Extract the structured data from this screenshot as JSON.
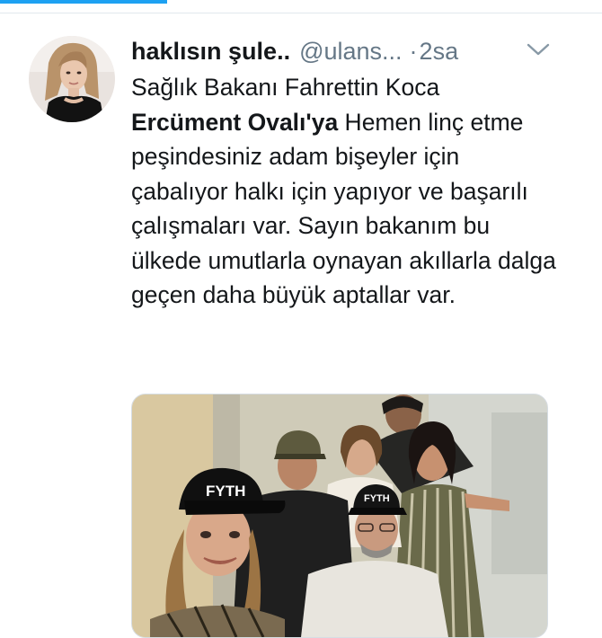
{
  "tweet": {
    "display_name": "haklısın şule..",
    "handle": "@ulans...",
    "separator": "·",
    "time": "2sa",
    "text_line1": "Sağlık Bakanı Fahrettin Koca",
    "mention": "Ercüment Ovalı'ya",
    "text_after_mention": " Hemen linç etme peşindesiniz adam bişeyler için çabalıyor halkı için yapıyor ve başarılı çalışmaları var. Sayın bakanım bu ülkede umutlarla oynayan akıllarla dalga geçen daha büyük aptallar var.",
    "cap_text": "FYTH",
    "icons": [
      "avatar",
      "chevron-down-icon"
    ],
    "colors": {
      "accent": "#1da1f2",
      "secondary_text": "#657786",
      "primary_text": "#14171a"
    }
  }
}
